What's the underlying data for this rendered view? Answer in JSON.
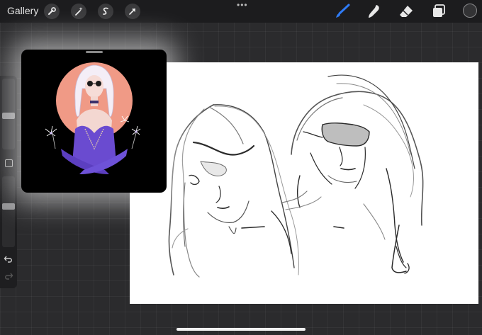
{
  "toolbar": {
    "gallery_label": "Gallery",
    "left_tools": [
      {
        "name": "wrench-icon"
      },
      {
        "name": "magic-wand-icon"
      },
      {
        "name": "selection-icon"
      },
      {
        "name": "transform-arrow-icon"
      }
    ],
    "right_tools": [
      {
        "name": "brush-icon",
        "active": true
      },
      {
        "name": "smudge-icon"
      },
      {
        "name": "eraser-icon"
      },
      {
        "name": "layers-icon"
      }
    ],
    "active_color": "#333335",
    "accent_color": "#2f7bf6"
  },
  "sidebar": {
    "undo_icon": "undo-icon",
    "redo_icon": "redo-icon",
    "modify_icon": "square-modify-icon"
  },
  "reference_window": {
    "image": "reference-illustration",
    "colors": {
      "background": "#000000",
      "circle": "#f09a86",
      "dress": "#6a4bd0",
      "hair": "#f3eef6"
    }
  }
}
